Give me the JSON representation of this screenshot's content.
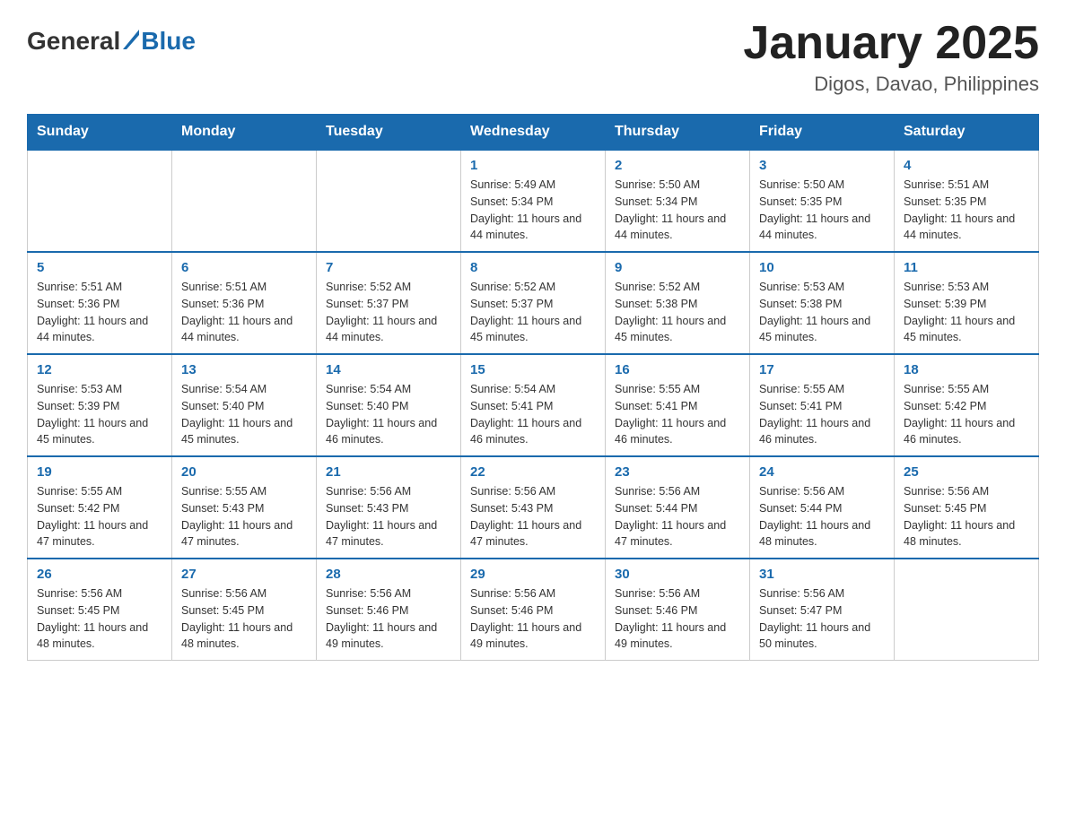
{
  "header": {
    "logo_general": "General",
    "logo_blue": "Blue",
    "month_title": "January 2025",
    "location": "Digos, Davao, Philippines"
  },
  "days_of_week": [
    "Sunday",
    "Monday",
    "Tuesday",
    "Wednesday",
    "Thursday",
    "Friday",
    "Saturday"
  ],
  "weeks": [
    [
      {
        "day": "",
        "info": ""
      },
      {
        "day": "",
        "info": ""
      },
      {
        "day": "",
        "info": ""
      },
      {
        "day": "1",
        "info": "Sunrise: 5:49 AM\nSunset: 5:34 PM\nDaylight: 11 hours and 44 minutes."
      },
      {
        "day": "2",
        "info": "Sunrise: 5:50 AM\nSunset: 5:34 PM\nDaylight: 11 hours and 44 minutes."
      },
      {
        "day": "3",
        "info": "Sunrise: 5:50 AM\nSunset: 5:35 PM\nDaylight: 11 hours and 44 minutes."
      },
      {
        "day": "4",
        "info": "Sunrise: 5:51 AM\nSunset: 5:35 PM\nDaylight: 11 hours and 44 minutes."
      }
    ],
    [
      {
        "day": "5",
        "info": "Sunrise: 5:51 AM\nSunset: 5:36 PM\nDaylight: 11 hours and 44 minutes."
      },
      {
        "day": "6",
        "info": "Sunrise: 5:51 AM\nSunset: 5:36 PM\nDaylight: 11 hours and 44 minutes."
      },
      {
        "day": "7",
        "info": "Sunrise: 5:52 AM\nSunset: 5:37 PM\nDaylight: 11 hours and 44 minutes."
      },
      {
        "day": "8",
        "info": "Sunrise: 5:52 AM\nSunset: 5:37 PM\nDaylight: 11 hours and 45 minutes."
      },
      {
        "day": "9",
        "info": "Sunrise: 5:52 AM\nSunset: 5:38 PM\nDaylight: 11 hours and 45 minutes."
      },
      {
        "day": "10",
        "info": "Sunrise: 5:53 AM\nSunset: 5:38 PM\nDaylight: 11 hours and 45 minutes."
      },
      {
        "day": "11",
        "info": "Sunrise: 5:53 AM\nSunset: 5:39 PM\nDaylight: 11 hours and 45 minutes."
      }
    ],
    [
      {
        "day": "12",
        "info": "Sunrise: 5:53 AM\nSunset: 5:39 PM\nDaylight: 11 hours and 45 minutes."
      },
      {
        "day": "13",
        "info": "Sunrise: 5:54 AM\nSunset: 5:40 PM\nDaylight: 11 hours and 45 minutes."
      },
      {
        "day": "14",
        "info": "Sunrise: 5:54 AM\nSunset: 5:40 PM\nDaylight: 11 hours and 46 minutes."
      },
      {
        "day": "15",
        "info": "Sunrise: 5:54 AM\nSunset: 5:41 PM\nDaylight: 11 hours and 46 minutes."
      },
      {
        "day": "16",
        "info": "Sunrise: 5:55 AM\nSunset: 5:41 PM\nDaylight: 11 hours and 46 minutes."
      },
      {
        "day": "17",
        "info": "Sunrise: 5:55 AM\nSunset: 5:41 PM\nDaylight: 11 hours and 46 minutes."
      },
      {
        "day": "18",
        "info": "Sunrise: 5:55 AM\nSunset: 5:42 PM\nDaylight: 11 hours and 46 minutes."
      }
    ],
    [
      {
        "day": "19",
        "info": "Sunrise: 5:55 AM\nSunset: 5:42 PM\nDaylight: 11 hours and 47 minutes."
      },
      {
        "day": "20",
        "info": "Sunrise: 5:55 AM\nSunset: 5:43 PM\nDaylight: 11 hours and 47 minutes."
      },
      {
        "day": "21",
        "info": "Sunrise: 5:56 AM\nSunset: 5:43 PM\nDaylight: 11 hours and 47 minutes."
      },
      {
        "day": "22",
        "info": "Sunrise: 5:56 AM\nSunset: 5:43 PM\nDaylight: 11 hours and 47 minutes."
      },
      {
        "day": "23",
        "info": "Sunrise: 5:56 AM\nSunset: 5:44 PM\nDaylight: 11 hours and 47 minutes."
      },
      {
        "day": "24",
        "info": "Sunrise: 5:56 AM\nSunset: 5:44 PM\nDaylight: 11 hours and 48 minutes."
      },
      {
        "day": "25",
        "info": "Sunrise: 5:56 AM\nSunset: 5:45 PM\nDaylight: 11 hours and 48 minutes."
      }
    ],
    [
      {
        "day": "26",
        "info": "Sunrise: 5:56 AM\nSunset: 5:45 PM\nDaylight: 11 hours and 48 minutes."
      },
      {
        "day": "27",
        "info": "Sunrise: 5:56 AM\nSunset: 5:45 PM\nDaylight: 11 hours and 48 minutes."
      },
      {
        "day": "28",
        "info": "Sunrise: 5:56 AM\nSunset: 5:46 PM\nDaylight: 11 hours and 49 minutes."
      },
      {
        "day": "29",
        "info": "Sunrise: 5:56 AM\nSunset: 5:46 PM\nDaylight: 11 hours and 49 minutes."
      },
      {
        "day": "30",
        "info": "Sunrise: 5:56 AM\nSunset: 5:46 PM\nDaylight: 11 hours and 49 minutes."
      },
      {
        "day": "31",
        "info": "Sunrise: 5:56 AM\nSunset: 5:47 PM\nDaylight: 11 hours and 50 minutes."
      },
      {
        "day": "",
        "info": ""
      }
    ]
  ]
}
